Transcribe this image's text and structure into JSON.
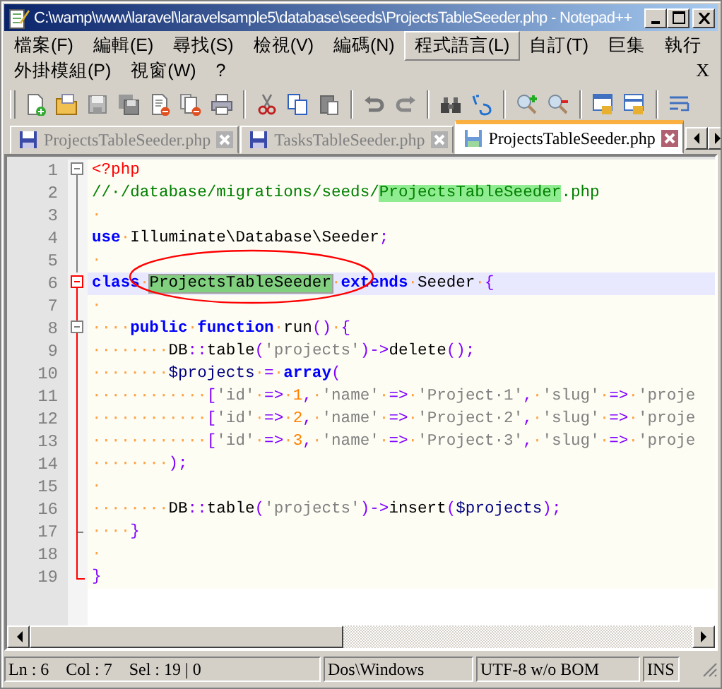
{
  "window": {
    "title": "C:\\wamp\\www\\laravel\\laravelsample5\\database\\seeds\\ProjectsTableSeeder.php - Notepad++"
  },
  "menu_bar": {
    "rows": [
      {
        "items": [
          {
            "label": "檔案(F)",
            "selected": false
          },
          {
            "label": "編輯(E)",
            "selected": false
          },
          {
            "label": "尋找(S)",
            "selected": false
          },
          {
            "label": "檢視(V)",
            "selected": false
          },
          {
            "label": "編碼(N)",
            "selected": false
          },
          {
            "label": "程式語言(L)",
            "selected": true
          },
          {
            "label": "自訂(T)",
            "selected": false
          },
          {
            "label": "巨集",
            "selected": false
          },
          {
            "label": "執行",
            "selected": false
          }
        ]
      },
      {
        "items": [
          {
            "label": "外掛模組(P)",
            "selected": false
          },
          {
            "label": "視窗(W)",
            "selected": false
          },
          {
            "label": "?",
            "selected": false
          }
        ]
      }
    ],
    "close": "X"
  },
  "tabs": [
    {
      "label": "ProjectsTableSeeder.php",
      "selected": false
    },
    {
      "label": "TasksTableSeeder.php",
      "selected": false
    },
    {
      "label": "ProjectsTableSeeder.php",
      "selected": true
    }
  ],
  "editor": {
    "lines": [
      {
        "number": "1",
        "expanded": true,
        "selected": false,
        "tokens": [
          {
            "kind": "tag",
            "text": "<?php"
          }
        ]
      },
      {
        "number": "2",
        "selected": false,
        "tokens": [
          {
            "kind": "comment",
            "text": "//·/database/migrations/seeds/"
          },
          {
            "kind": "comment-match",
            "text": "ProjectsTableSeeder"
          },
          {
            "kind": "comment",
            "text": ".php"
          }
        ]
      },
      {
        "number": "3",
        "selected": false,
        "tokens": [
          {
            "kind": "space",
            "text": "·"
          }
        ]
      },
      {
        "number": "4",
        "selected": false,
        "tokens": [
          {
            "kind": "keyword",
            "text": "use"
          },
          {
            "kind": "space",
            "text": "·"
          },
          {
            "kind": "plain",
            "text": "Illuminate\\Database\\Seeder"
          },
          {
            "kind": "operator",
            "text": ";"
          }
        ]
      },
      {
        "number": "5",
        "selected": false,
        "tokens": [
          {
            "kind": "space",
            "text": "·"
          }
        ]
      },
      {
        "number": "6",
        "expanded": true,
        "selected": true,
        "tokens": [
          {
            "kind": "keyword",
            "text": "class"
          },
          {
            "kind": "space",
            "text": "·"
          },
          {
            "kind": "match",
            "text": "ProjectsTableSeeder"
          },
          {
            "kind": "space",
            "text": "·"
          },
          {
            "kind": "keyword",
            "text": "extends"
          },
          {
            "kind": "space",
            "text": "·"
          },
          {
            "kind": "plain",
            "text": "Seeder"
          },
          {
            "kind": "space",
            "text": "·"
          },
          {
            "kind": "operator",
            "text": "{"
          }
        ]
      },
      {
        "number": "7",
        "selected": false,
        "tokens": [
          {
            "kind": "space",
            "text": "·"
          }
        ]
      },
      {
        "number": "8",
        "expanded": true,
        "selected": false,
        "tokens": [
          {
            "kind": "space",
            "text": "····"
          },
          {
            "kind": "keyword",
            "text": "public"
          },
          {
            "kind": "space",
            "text": "·"
          },
          {
            "kind": "keyword",
            "text": "function"
          },
          {
            "kind": "space",
            "text": "·"
          },
          {
            "kind": "plain",
            "text": "run"
          },
          {
            "kind": "operator",
            "text": "()"
          },
          {
            "kind": "space",
            "text": "·"
          },
          {
            "kind": "operator",
            "text": "{"
          }
        ]
      },
      {
        "number": "9",
        "selected": false,
        "tokens": [
          {
            "kind": "space",
            "text": "········"
          },
          {
            "kind": "plain",
            "text": "DB"
          },
          {
            "kind": "operator",
            "text": "::"
          },
          {
            "kind": "plain",
            "text": "table"
          },
          {
            "kind": "operator",
            "text": "("
          },
          {
            "kind": "string",
            "text": "'projects'"
          },
          {
            "kind": "operator",
            "text": ")->"
          },
          {
            "kind": "plain",
            "text": "delete"
          },
          {
            "kind": "operator",
            "text": "();"
          }
        ]
      },
      {
        "number": "10",
        "selected": false,
        "tokens": [
          {
            "kind": "space",
            "text": "········"
          },
          {
            "kind": "variable",
            "text": "$projects"
          },
          {
            "kind": "space",
            "text": "·"
          },
          {
            "kind": "operator",
            "text": "="
          },
          {
            "kind": "space",
            "text": "·"
          },
          {
            "kind": "keyword",
            "text": "array"
          },
          {
            "kind": "operator",
            "text": "("
          }
        ]
      },
      {
        "number": "11",
        "selected": false,
        "tokens": [
          {
            "kind": "space",
            "text": "············"
          },
          {
            "kind": "operator",
            "text": "["
          },
          {
            "kind": "string",
            "text": "'id'"
          },
          {
            "kind": "space",
            "text": "·"
          },
          {
            "kind": "operator",
            "text": "=>"
          },
          {
            "kind": "space",
            "text": "·"
          },
          {
            "kind": "number",
            "text": "1"
          },
          {
            "kind": "operator",
            "text": ","
          },
          {
            "kind": "space",
            "text": "·"
          },
          {
            "kind": "string",
            "text": "'name'"
          },
          {
            "kind": "space",
            "text": "·"
          },
          {
            "kind": "operator",
            "text": "=>"
          },
          {
            "kind": "space",
            "text": "·"
          },
          {
            "kind": "string",
            "text": "'Project·1'"
          },
          {
            "kind": "operator",
            "text": ","
          },
          {
            "kind": "space",
            "text": "·"
          },
          {
            "kind": "string",
            "text": "'slug'"
          },
          {
            "kind": "space",
            "text": "·"
          },
          {
            "kind": "operator",
            "text": "=>"
          },
          {
            "kind": "space",
            "text": "·"
          },
          {
            "kind": "string",
            "text": "'proje"
          }
        ]
      },
      {
        "number": "12",
        "selected": false,
        "tokens": [
          {
            "kind": "space",
            "text": "············"
          },
          {
            "kind": "operator",
            "text": "["
          },
          {
            "kind": "string",
            "text": "'id'"
          },
          {
            "kind": "space",
            "text": "·"
          },
          {
            "kind": "operator",
            "text": "=>"
          },
          {
            "kind": "space",
            "text": "·"
          },
          {
            "kind": "number",
            "text": "2"
          },
          {
            "kind": "operator",
            "text": ","
          },
          {
            "kind": "space",
            "text": "·"
          },
          {
            "kind": "string",
            "text": "'name'"
          },
          {
            "kind": "space",
            "text": "·"
          },
          {
            "kind": "operator",
            "text": "=>"
          },
          {
            "kind": "space",
            "text": "·"
          },
          {
            "kind": "string",
            "text": "'Project·2'"
          },
          {
            "kind": "operator",
            "text": ","
          },
          {
            "kind": "space",
            "text": "·"
          },
          {
            "kind": "string",
            "text": "'slug'"
          },
          {
            "kind": "space",
            "text": "·"
          },
          {
            "kind": "operator",
            "text": "=>"
          },
          {
            "kind": "space",
            "text": "·"
          },
          {
            "kind": "string",
            "text": "'proje"
          }
        ]
      },
      {
        "number": "13",
        "selected": false,
        "tokens": [
          {
            "kind": "space",
            "text": "············"
          },
          {
            "kind": "operator",
            "text": "["
          },
          {
            "kind": "string",
            "text": "'id'"
          },
          {
            "kind": "space",
            "text": "·"
          },
          {
            "kind": "operator",
            "text": "=>"
          },
          {
            "kind": "space",
            "text": "·"
          },
          {
            "kind": "number",
            "text": "3"
          },
          {
            "kind": "operator",
            "text": ","
          },
          {
            "kind": "space",
            "text": "·"
          },
          {
            "kind": "string",
            "text": "'name'"
          },
          {
            "kind": "space",
            "text": "·"
          },
          {
            "kind": "operator",
            "text": "=>"
          },
          {
            "kind": "space",
            "text": "·"
          },
          {
            "kind": "string",
            "text": "'Project·3'"
          },
          {
            "kind": "operator",
            "text": ","
          },
          {
            "kind": "space",
            "text": "·"
          },
          {
            "kind": "string",
            "text": "'slug'"
          },
          {
            "kind": "space",
            "text": "·"
          },
          {
            "kind": "operator",
            "text": "=>"
          },
          {
            "kind": "space",
            "text": "·"
          },
          {
            "kind": "string",
            "text": "'proje"
          }
        ]
      },
      {
        "number": "14",
        "selected": false,
        "tokens": [
          {
            "kind": "space",
            "text": "········"
          },
          {
            "kind": "operator",
            "text": ");"
          }
        ]
      },
      {
        "number": "15",
        "selected": false,
        "tokens": [
          {
            "kind": "space",
            "text": "·"
          }
        ]
      },
      {
        "number": "16",
        "selected": false,
        "tokens": [
          {
            "kind": "space",
            "text": "········"
          },
          {
            "kind": "plain",
            "text": "DB"
          },
          {
            "kind": "operator",
            "text": "::"
          },
          {
            "kind": "plain",
            "text": "table"
          },
          {
            "kind": "operator",
            "text": "("
          },
          {
            "kind": "string",
            "text": "'projects'"
          },
          {
            "kind": "operator",
            "text": ")->"
          },
          {
            "kind": "plain",
            "text": "insert"
          },
          {
            "kind": "operator",
            "text": "("
          },
          {
            "kind": "variable",
            "text": "$projects"
          },
          {
            "kind": "operator",
            "text": ");"
          }
        ]
      },
      {
        "number": "17",
        "selected": false,
        "tokens": [
          {
            "kind": "space",
            "text": "····"
          },
          {
            "kind": "operator",
            "text": "}"
          }
        ]
      },
      {
        "number": "18",
        "selected": false,
        "tokens": [
          {
            "kind": "space",
            "text": "·"
          }
        ]
      },
      {
        "number": "19",
        "selected": false,
        "tokens": [
          {
            "kind": "operator",
            "text": "}"
          }
        ]
      }
    ]
  },
  "status_bar": {
    "position": [
      "Ln : 6",
      "Col : 7",
      "Sel : 19 | 0"
    ],
    "line_ending": "Dos\\Windows",
    "encoding": "UTF-8 w/o BOM",
    "mode": "INS"
  }
}
